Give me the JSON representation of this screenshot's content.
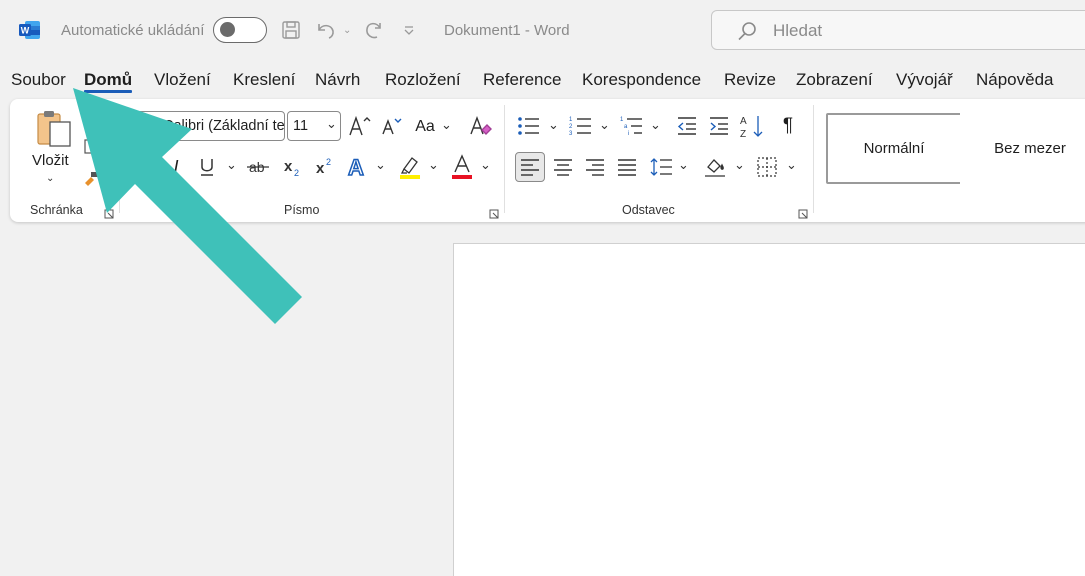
{
  "titlebar": {
    "app_icon": "word-logo",
    "autosave_label": "Automatické ukládání",
    "doc_title": "Dokument1  -  Word",
    "search_placeholder": "Hledat"
  },
  "tabs": [
    {
      "label": "Soubor"
    },
    {
      "label": "Domů"
    },
    {
      "label": "Vložení"
    },
    {
      "label": "Kreslení"
    },
    {
      "label": "Návrh"
    },
    {
      "label": "Rozložení"
    },
    {
      "label": "Reference"
    },
    {
      "label": "Korespondence"
    },
    {
      "label": "Revize"
    },
    {
      "label": "Zobrazení"
    },
    {
      "label": "Vývojář"
    },
    {
      "label": "Nápověda"
    }
  ],
  "ribbon": {
    "clipboard": {
      "paste_label": "Vložit",
      "group_label": "Schránka"
    },
    "font": {
      "font_name": "Calibri (Základní text)",
      "font_size": "11",
      "group_label": "Písmo",
      "case_label": "Aa"
    },
    "paragraph": {
      "group_label": "Odstavec"
    },
    "styles": {
      "normal_label": "Normální",
      "no_spacing_label": "Bez mezer"
    }
  },
  "colors": {
    "accent": "#1b5db8",
    "arrow": "#3fc1b9",
    "highlight": "#ffef00",
    "font_color": "#e81123"
  }
}
